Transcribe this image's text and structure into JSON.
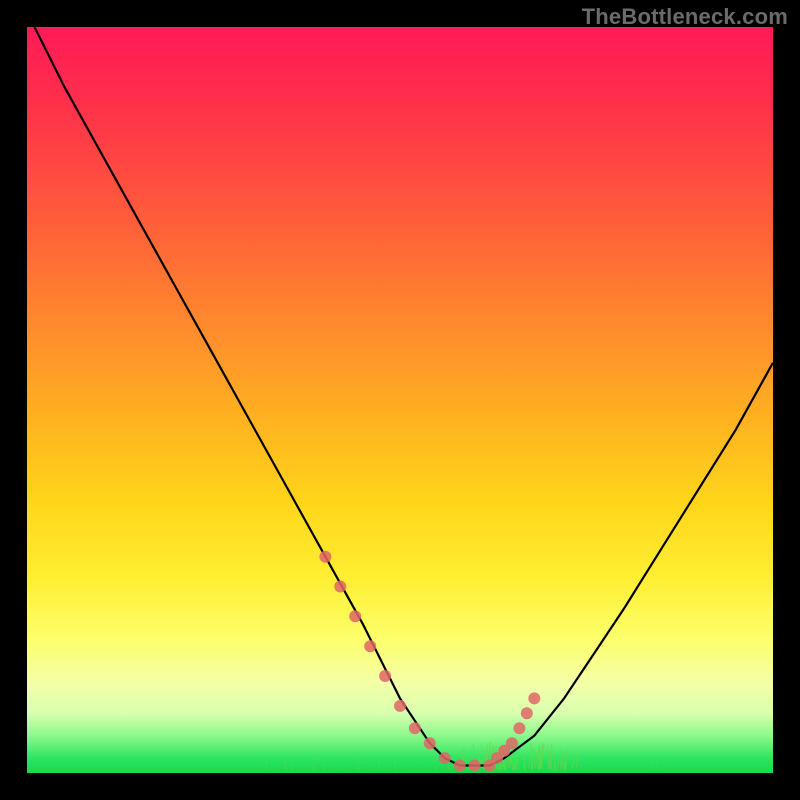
{
  "watermark": "TheBottleneck.com",
  "chart_data": {
    "type": "line",
    "title": "",
    "xlabel": "",
    "ylabel": "",
    "xlim": [
      0,
      100
    ],
    "ylim": [
      0,
      100
    ],
    "series": [
      {
        "name": "bottleneck-curve",
        "x": [
          1,
          5,
          10,
          15,
          20,
          25,
          30,
          35,
          40,
          45,
          48,
          50,
          52,
          54,
          56,
          58,
          60,
          62,
          64,
          68,
          72,
          76,
          80,
          85,
          90,
          95,
          100
        ],
        "values": [
          100,
          92,
          83,
          74,
          65,
          56,
          47,
          38,
          29,
          20,
          14,
          10,
          7,
          4,
          2,
          1,
          1,
          1,
          2,
          5,
          10,
          16,
          22,
          30,
          38,
          46,
          55
        ]
      }
    ],
    "markers": {
      "name": "highlighted-points",
      "color": "#e06666",
      "x": [
        40,
        42,
        44,
        46,
        48,
        50,
        52,
        54,
        56,
        58,
        60,
        62,
        63,
        64,
        65,
        66,
        67,
        68
      ],
      "values": [
        29,
        25,
        21,
        17,
        13,
        9,
        6,
        4,
        2,
        1,
        1,
        1,
        2,
        3,
        4,
        6,
        8,
        10
      ]
    },
    "grass": {
      "name": "grass-strokes",
      "color": "#6fd64a",
      "band_y": [
        0,
        3
      ]
    }
  }
}
